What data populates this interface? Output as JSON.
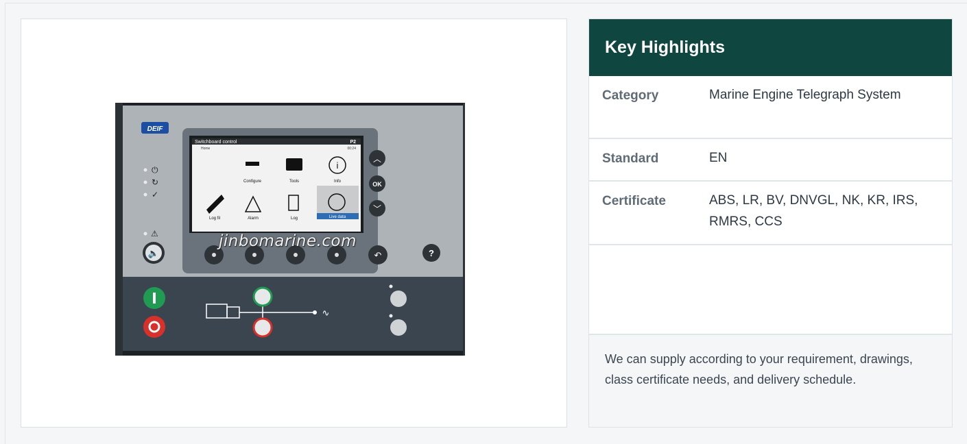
{
  "product_image": {
    "brand_logo": "DEIF",
    "screen_title": "Switchboard control",
    "screen_page": "P2",
    "screen_breadcrumb": "Home",
    "screen_time": "00:24",
    "menu_items": [
      "Configure",
      "Tools",
      "Info",
      "Log fil",
      "Alarm",
      "Log",
      "Live data"
    ],
    "ok_label": "OK",
    "help_label": "?",
    "watermark": "jinbomarine.com"
  },
  "highlights": {
    "title": "Key Highlights",
    "rows": [
      {
        "label": "Category",
        "value": "Marine Engine Telegraph System"
      },
      {
        "label": "Standard",
        "value": "EN"
      },
      {
        "label": "Certificate",
        "value": "ABS, LR, BV, DNVGL, NK, KR, IRS, RMRS, CCS"
      }
    ],
    "note": "We can supply according to your requirement, drawings, class certificate needs, and delivery schedule."
  },
  "colors": {
    "header_bg": "#0f463f",
    "start_button": "#1f9b52",
    "stop_button": "#d8302b"
  }
}
